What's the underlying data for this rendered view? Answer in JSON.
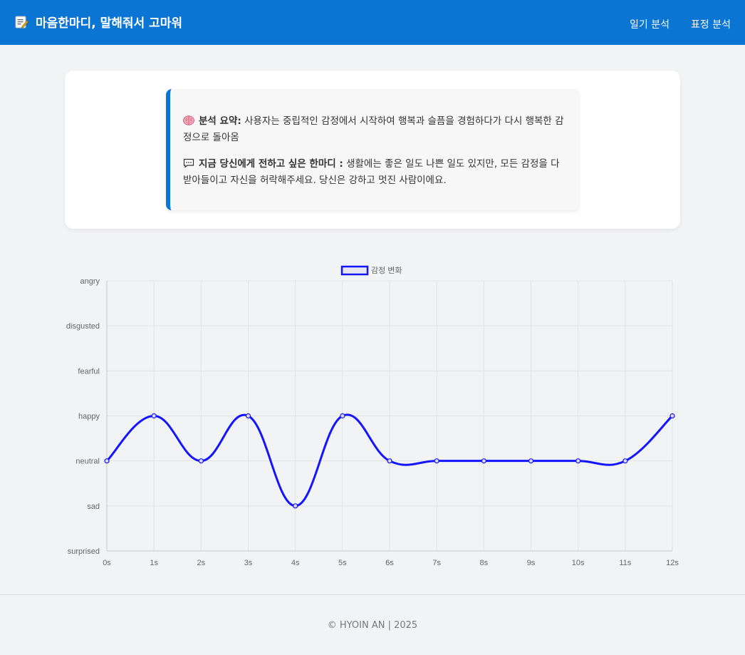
{
  "header": {
    "title": "마음한마디, 말해줘서 고마워",
    "nav": [
      "일기 분석",
      "표정 분석"
    ],
    "color": "#0b75d4"
  },
  "summary": {
    "analysis_label": "분석 요약:",
    "analysis_text": "사용자는 중립적인 감정에서 시작하여 행복과 슬픔을 경험하다가 다시 행복한 감정으로 돌아옴",
    "message_label": "지금 당신에게 전하고 싶은 한마디 :",
    "message_text": "생활에는 좋은 일도 나쁜 일도 있지만, 모든 감정을 다 받아들이고 자신을 허락해주세요. 당신은 강하고 멋진 사람이에요."
  },
  "chart_data": {
    "type": "line",
    "legend": "감정 변화",
    "x": [
      "0s",
      "1s",
      "2s",
      "3s",
      "4s",
      "5s",
      "6s",
      "7s",
      "8s",
      "9s",
      "10s",
      "11s",
      "12s"
    ],
    "y_categories": [
      "surprised",
      "sad",
      "neutral",
      "happy",
      "fearful",
      "disgusted",
      "angry"
    ],
    "values": [
      "neutral",
      "happy",
      "neutral",
      "happy",
      "sad",
      "happy",
      "neutral",
      "neutral",
      "neutral",
      "neutral",
      "neutral",
      "neutral",
      "happy"
    ],
    "line_color": "#1414ff",
    "grid": true,
    "legend_position": "top"
  },
  "footer": {
    "text": "© HYOIN AN | 2025"
  }
}
